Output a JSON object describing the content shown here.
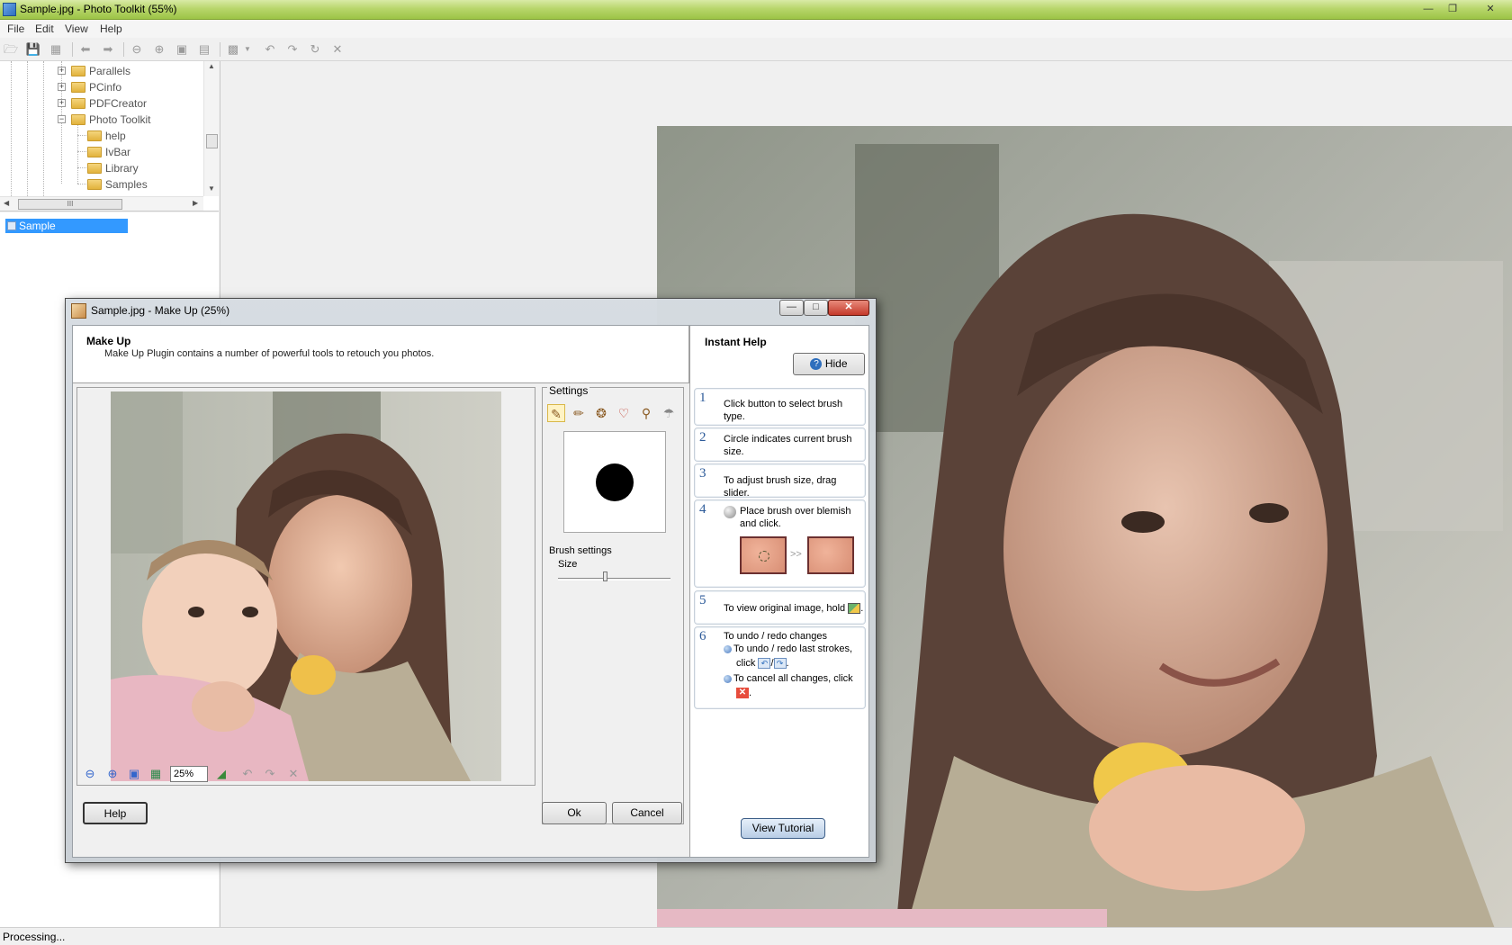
{
  "window": {
    "title": "Sample.jpg - Photo Toolkit (55%)",
    "controls": [
      "minimize",
      "restore",
      "close"
    ]
  },
  "menu": [
    "File",
    "Edit",
    "View",
    "Help"
  ],
  "toolbar": {
    "icons": [
      "open-icon",
      "save-icon",
      "save-all-icon",
      "back-arrow-icon",
      "forward-arrow-icon",
      "zoom-out-icon",
      "zoom-in-icon",
      "fit-screen-icon",
      "actual-size-icon",
      "plugin-icon",
      "undo-icon",
      "redo-icon",
      "rotate-icon",
      "cancel-icon"
    ]
  },
  "tree": {
    "items": [
      {
        "label": "Parallels",
        "level": 1,
        "expander": "+"
      },
      {
        "label": "PCinfo",
        "level": 1,
        "expander": "+"
      },
      {
        "label": "PDFCreator",
        "level": 1,
        "expander": "+"
      },
      {
        "label": "Photo Toolkit",
        "level": 1,
        "expander": "−"
      },
      {
        "label": "help",
        "level": 2
      },
      {
        "label": "IvBar",
        "level": 2
      },
      {
        "label": "Library",
        "level": 2
      },
      {
        "label": "Samples",
        "level": 2
      }
    ],
    "hscroll_glyph": "III"
  },
  "file_list": {
    "selected": "Sample"
  },
  "status": "Processing...",
  "dialog": {
    "title": "Sample.jpg - Make Up (25%)",
    "header_title": "Make Up",
    "header_desc": "Make Up Plugin contains a number of powerful tools to retouch you photos.",
    "settings_legend": "Settings",
    "brush_settings_label": "Brush settings",
    "size_label": "Size",
    "brush_size_fraction": 0.42,
    "zoom_value": "25%",
    "help_button": "Help",
    "ok_button": "Ok",
    "cancel_button": "Cancel",
    "brush_tools": [
      "brush-icon",
      "eraser-icon",
      "cookie-icon",
      "lips-icon",
      "wand-icon",
      "smudge-icon"
    ],
    "bottom_tools": [
      "zoom-out-icon",
      "zoom-in-icon",
      "fit-icon",
      "histogram-icon"
    ]
  },
  "instant_help": {
    "title": "Instant Help",
    "hide_button": "Hide",
    "steps": [
      {
        "num": "1",
        "text": "Click button to select brush type."
      },
      {
        "num": "2",
        "text": "Circle indicates current brush size."
      },
      {
        "num": "3",
        "text": "To adjust brush size, drag slider."
      },
      {
        "num": "4",
        "text": "Place brush over blemish and click.",
        "arrow": ">>"
      },
      {
        "num": "5",
        "text": "To view original image, hold",
        "suffix": "."
      },
      {
        "num": "6",
        "text": "To undo / redo changes",
        "bullet1": "To undo / redo last strokes,",
        "bullet1b": "click",
        "separator": "/",
        "bullet2": "To cancel all changes, click"
      }
    ],
    "tutorial_button": "View Tutorial"
  },
  "colors": {
    "titlebar": "#9cc446",
    "selection": "#3399ff",
    "help_number": "#2c5a99"
  }
}
